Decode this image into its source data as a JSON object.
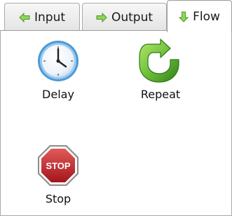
{
  "tabs": [
    {
      "label": "Input",
      "icon": "arrow-left-icon"
    },
    {
      "label": "Output",
      "icon": "arrow-right-icon"
    },
    {
      "label": "Flow",
      "icon": "arrow-down-icon",
      "active": true
    }
  ],
  "items": [
    {
      "label": "Delay",
      "icon": "clock-icon"
    },
    {
      "label": "Repeat",
      "icon": "repeat-arrow-icon"
    },
    {
      "label": "Stop",
      "icon": "stop-sign-icon",
      "sign_text": "STOP"
    }
  ],
  "colors": {
    "arrow_green": "#6fbf3a",
    "clock_blue": "#4a9ad8",
    "stop_red": "#c0272d"
  }
}
